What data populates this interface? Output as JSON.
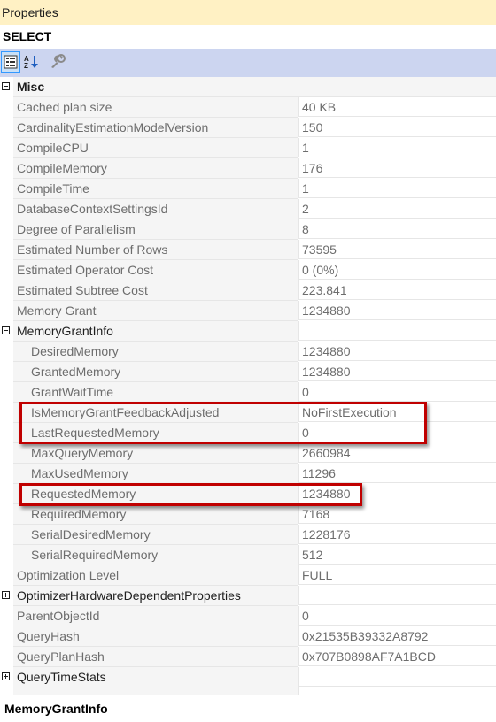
{
  "window": {
    "title": "Properties"
  },
  "object": {
    "name": "SELECT"
  },
  "toolbar": {
    "buttons": [
      {
        "icon": "categorized-icon",
        "active": true
      },
      {
        "icon": "alphabetical-sort-icon",
        "active": false
      },
      {
        "icon": "property-pages-wrench-icon",
        "active": false
      }
    ]
  },
  "grid": {
    "rows": [
      {
        "type": "category",
        "name": "Misc",
        "expanded": true
      },
      {
        "type": "prop",
        "name": "Cached plan size",
        "value": "40 KB"
      },
      {
        "type": "prop",
        "name": "CardinalityEstimationModelVersion",
        "value": "150"
      },
      {
        "type": "prop",
        "name": "CompileCPU",
        "value": "1"
      },
      {
        "type": "prop",
        "name": "CompileMemory",
        "value": "176"
      },
      {
        "type": "prop",
        "name": "CompileTime",
        "value": "1"
      },
      {
        "type": "prop",
        "name": "DatabaseContextSettingsId",
        "value": "2"
      },
      {
        "type": "prop",
        "name": "Degree of Parallelism",
        "value": "8"
      },
      {
        "type": "prop",
        "name": "Estimated Number of Rows",
        "value": "73595"
      },
      {
        "type": "prop",
        "name": "Estimated Operator Cost",
        "value": "0 (0%)"
      },
      {
        "type": "prop",
        "name": "Estimated Subtree Cost",
        "value": "223.841"
      },
      {
        "type": "prop",
        "name": "Memory Grant",
        "value": "1234880"
      },
      {
        "type": "group",
        "name": "MemoryGrantInfo",
        "value": "",
        "expanded": true
      },
      {
        "type": "child",
        "name": "DesiredMemory",
        "value": "1234880"
      },
      {
        "type": "child",
        "name": "GrantedMemory",
        "value": "1234880"
      },
      {
        "type": "child",
        "name": "GrantWaitTime",
        "value": "0"
      },
      {
        "type": "child",
        "name": "IsMemoryGrantFeedbackAdjusted",
        "value": "NoFirstExecution"
      },
      {
        "type": "child",
        "name": "LastRequestedMemory",
        "value": "0"
      },
      {
        "type": "child",
        "name": "MaxQueryMemory",
        "value": "2660984"
      },
      {
        "type": "child",
        "name": "MaxUsedMemory",
        "value": "11296"
      },
      {
        "type": "child",
        "name": "RequestedMemory",
        "value": "1234880"
      },
      {
        "type": "child",
        "name": "RequiredMemory",
        "value": "7168"
      },
      {
        "type": "child",
        "name": "SerialDesiredMemory",
        "value": "1228176"
      },
      {
        "type": "child",
        "name": "SerialRequiredMemory",
        "value": "512"
      },
      {
        "type": "prop",
        "name": "Optimization Level",
        "value": "FULL"
      },
      {
        "type": "group",
        "name": "OptimizerHardwareDependentProperties",
        "value": "",
        "expanded": false
      },
      {
        "type": "prop",
        "name": "ParentObjectId",
        "value": "0"
      },
      {
        "type": "prop",
        "name": "QueryHash",
        "value": "0x21535B39332A8792"
      },
      {
        "type": "prop",
        "name": "QueryPlanHash",
        "value": "0x707B0898AF7A1BCD"
      },
      {
        "type": "group",
        "name": "QueryTimeStats",
        "value": "",
        "expanded": false
      },
      {
        "type": "prop",
        "name": "",
        "value": ""
      }
    ]
  },
  "description": {
    "title": "MemoryGrantInfo"
  },
  "colors": {
    "titlebar": "#fff1c4",
    "toolbar": "#ccd5f0",
    "highlight": "#c00000",
    "name_cell": "#f5f5f5",
    "text_muted": "#6d6d6d"
  }
}
